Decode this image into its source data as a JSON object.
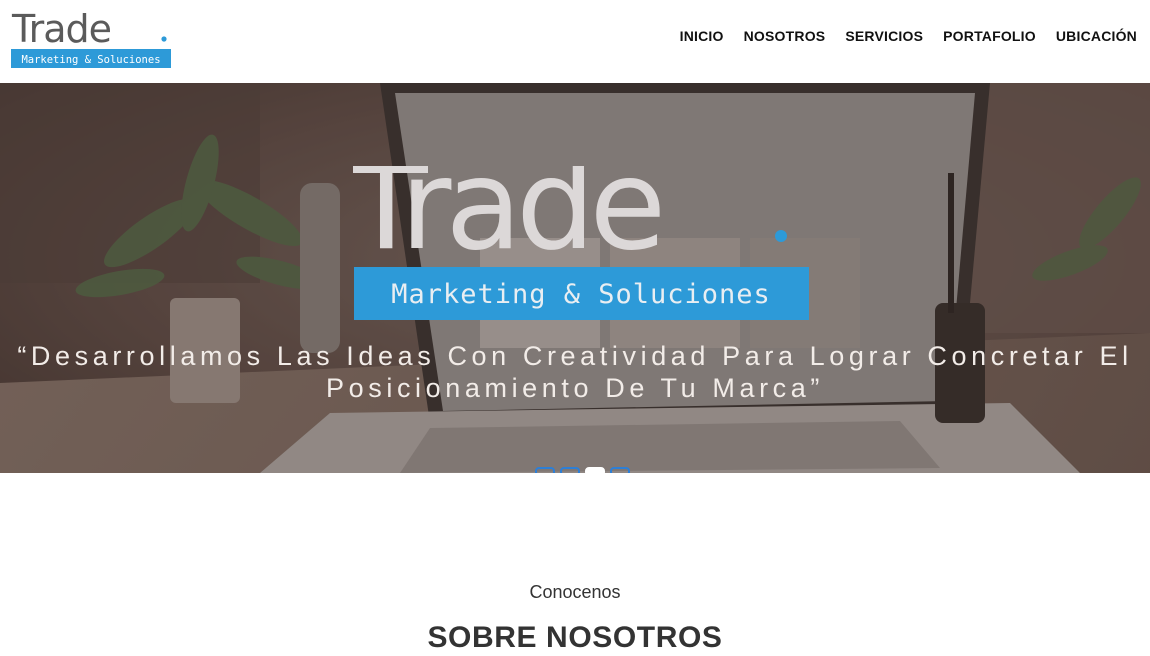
{
  "header": {
    "logo": {
      "word": "Trade",
      "subtitle": "Marketing & Soluciones"
    },
    "nav": [
      {
        "label": "INICIO"
      },
      {
        "label": "NOSOTROS"
      },
      {
        "label": "SERVICIOS"
      },
      {
        "label": "PORTAFOLIO"
      },
      {
        "label": "UBICACIÓN"
      }
    ]
  },
  "hero": {
    "logo": {
      "word": "Trade",
      "subtitle": "Marketing & Soluciones"
    },
    "tagline_line1": "“Desarrollamos Las Ideas Con Creatividad Para Lograr Concretar El",
    "tagline_line2": "Posicionamiento De Tu Marca”",
    "slides_count": 4,
    "active_slide": 3
  },
  "about": {
    "subtitle": "Conocenos",
    "title": "SOBRE NOSOTROS"
  },
  "colors": {
    "brand_blue": "#2d9ad8",
    "logo_gray": "#5b5b5b",
    "hero_overlay": "#5b4a43",
    "dot_border": "#2d7fd6"
  }
}
